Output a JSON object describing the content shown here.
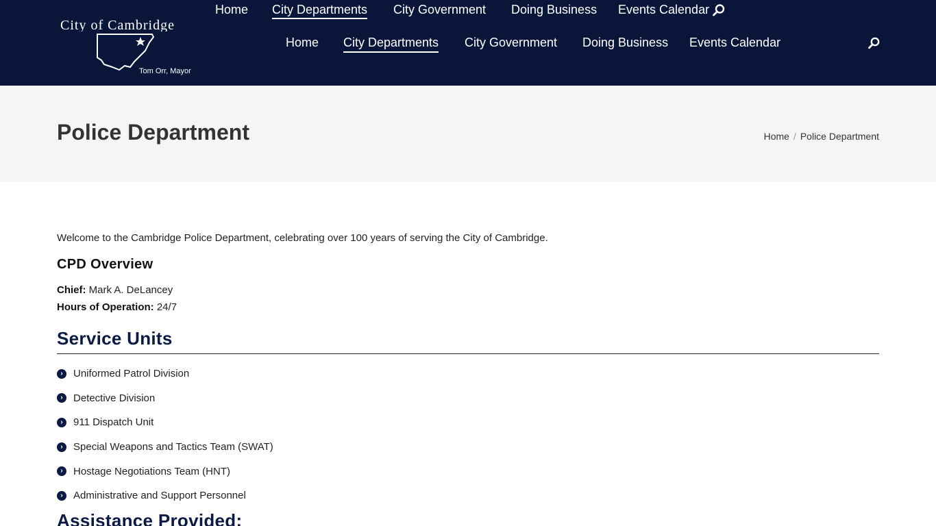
{
  "sticky_nav": {
    "items": [
      {
        "label": "Home",
        "active": false
      },
      {
        "label": "City Departments",
        "active": true
      },
      {
        "label": "City Government",
        "active": false
      },
      {
        "label": "Doing Business",
        "active": false
      },
      {
        "label": "Events Calendar",
        "active": false
      }
    ]
  },
  "header": {
    "logo": {
      "title": "City of Cambridge",
      "mayor": "Tom Orr, Mayor"
    },
    "nav": {
      "items": [
        {
          "label": "Home",
          "active": false
        },
        {
          "label": "City Departments",
          "active": true
        },
        {
          "label": "City Government",
          "active": false
        },
        {
          "label": "Doing Business",
          "active": false
        },
        {
          "label": "Events Calendar",
          "active": false
        }
      ]
    },
    "search_icon": "search-icon"
  },
  "title_bar": {
    "title": "Police Department",
    "breadcrumb": {
      "home": "Home",
      "separator": "/",
      "current": "Police Department"
    }
  },
  "content": {
    "intro": "Welcome to the Cambridge Police Department, celebrating over 100 years of serving the City of Cambridge.",
    "overview_heading": "CPD Overview",
    "chief_label": "Chief:",
    "chief_value": "Mark A. DeLancey",
    "hours_label": "Hours of Operation:",
    "hours_value": "24/7",
    "units_heading": "Service Units",
    "units": [
      "Uniformed Patrol Division",
      "Detective Division",
      "911 Dispatch Unit",
      "Special Weapons and Tactics Team (SWAT)",
      "Hostage Negotiations Team (HNT)",
      "Administrative and Support Personnel"
    ],
    "assistance_heading": "Assistance Provided:"
  },
  "colors": {
    "header_bg": "#09163a",
    "heading_navy": "#0a1a45",
    "titlebar_bg": "#f5f5f5"
  }
}
